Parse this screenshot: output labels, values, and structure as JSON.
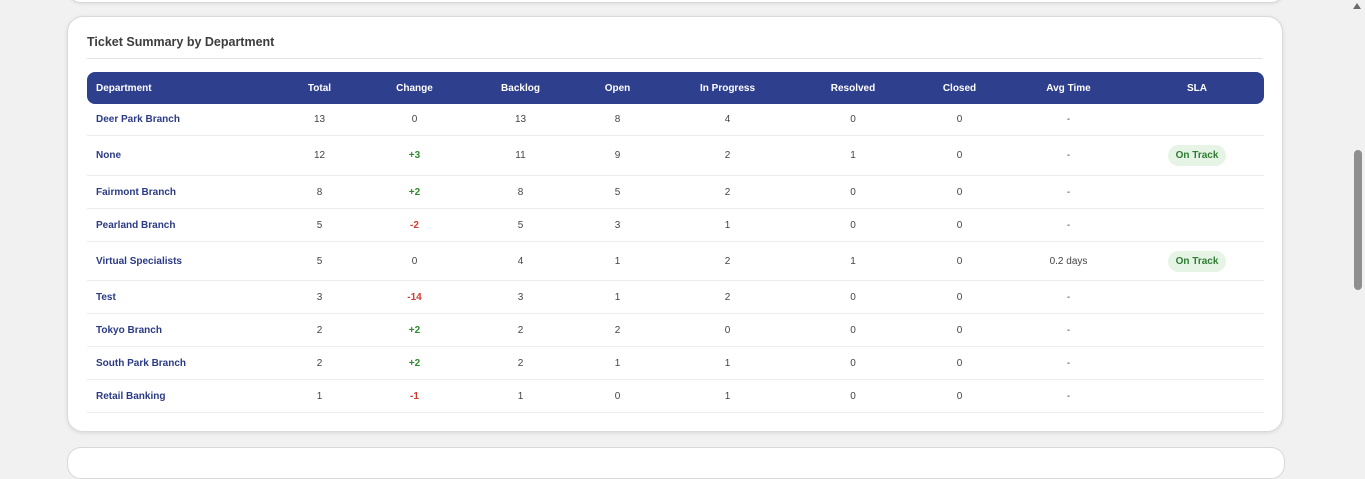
{
  "card": {
    "title": "Ticket Summary by Department"
  },
  "table": {
    "headers": [
      "Department",
      "Total",
      "Change",
      "Backlog",
      "Open",
      "In Progress",
      "Resolved",
      "Closed",
      "Avg Time",
      "SLA"
    ],
    "rows": [
      {
        "department": "Deer Park Branch",
        "total": "13",
        "change": "0",
        "change_kind": "zero",
        "backlog": "13",
        "open": "8",
        "in_progress": "4",
        "resolved": "0",
        "closed": "0",
        "avg_time": "-",
        "sla": ""
      },
      {
        "department": "None",
        "total": "12",
        "change": "+3",
        "change_kind": "pos",
        "backlog": "11",
        "open": "9",
        "in_progress": "2",
        "resolved": "1",
        "closed": "0",
        "avg_time": "-",
        "sla": "On Track"
      },
      {
        "department": "Fairmont Branch",
        "total": "8",
        "change": "+2",
        "change_kind": "pos",
        "backlog": "8",
        "open": "5",
        "in_progress": "2",
        "resolved": "0",
        "closed": "0",
        "avg_time": "-",
        "sla": ""
      },
      {
        "department": "Pearland Branch",
        "total": "5",
        "change": "-2",
        "change_kind": "neg",
        "backlog": "5",
        "open": "3",
        "in_progress": "1",
        "resolved": "0",
        "closed": "0",
        "avg_time": "-",
        "sla": ""
      },
      {
        "department": "Virtual Specialists",
        "total": "5",
        "change": "0",
        "change_kind": "zero",
        "backlog": "4",
        "open": "1",
        "in_progress": "2",
        "resolved": "1",
        "closed": "0",
        "avg_time": "0.2 days",
        "sla": "On Track"
      },
      {
        "department": "Test",
        "total": "3",
        "change": "-14",
        "change_kind": "neg",
        "backlog": "3",
        "open": "1",
        "in_progress": "2",
        "resolved": "0",
        "closed": "0",
        "avg_time": "-",
        "sla": ""
      },
      {
        "department": "Tokyo Branch",
        "total": "2",
        "change": "+2",
        "change_kind": "pos",
        "backlog": "2",
        "open": "2",
        "in_progress": "0",
        "resolved": "0",
        "closed": "0",
        "avg_time": "-",
        "sla": ""
      },
      {
        "department": "South Park Branch",
        "total": "2",
        "change": "+2",
        "change_kind": "pos",
        "backlog": "2",
        "open": "1",
        "in_progress": "1",
        "resolved": "0",
        "closed": "0",
        "avg_time": "-",
        "sla": ""
      },
      {
        "department": "Retail Banking",
        "total": "1",
        "change": "-1",
        "change_kind": "neg",
        "backlog": "1",
        "open": "0",
        "in_progress": "1",
        "resolved": "0",
        "closed": "0",
        "avg_time": "-",
        "sla": ""
      }
    ]
  },
  "colors": {
    "header_bg": "#2e3f8d",
    "department_text": "#2b3a85",
    "positive_change": "#2e8b2e",
    "negative_change": "#d33a2c",
    "sla_on_track_bg": "#e6f4e6",
    "sla_on_track_text": "#2e7d32"
  }
}
